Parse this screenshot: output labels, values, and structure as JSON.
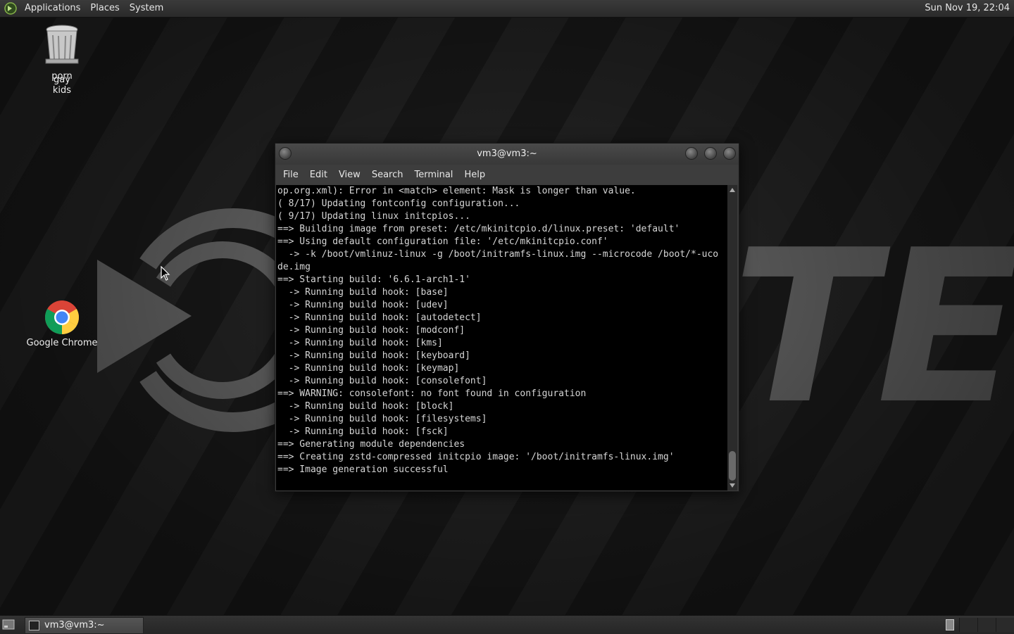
{
  "top_panel": {
    "menus": [
      "Applications",
      "Places",
      "System"
    ],
    "clock": "Sun Nov 19, 22:04"
  },
  "desktop": {
    "trash_label_lines": [
      "porn",
      "gay",
      "kids"
    ],
    "chrome_label": "Google Chrome",
    "wallpaper_text": "TE"
  },
  "terminal": {
    "title": "vm3@vm3:~",
    "menus": [
      "File",
      "Edit",
      "View",
      "Search",
      "Terminal",
      "Help"
    ],
    "lines": [
      "op.org.xml): Error in <match> element: Mask is longer than value.",
      "( 8/17) Updating fontconfig configuration...",
      "( 9/17) Updating linux initcpios...",
      "==> Building image from preset: /etc/mkinitcpio.d/linux.preset: 'default'",
      "==> Using default configuration file: '/etc/mkinitcpio.conf'",
      "  -> -k /boot/vmlinuz-linux -g /boot/initramfs-linux.img --microcode /boot/*-uco",
      "de.img",
      "==> Starting build: '6.6.1-arch1-1'",
      "  -> Running build hook: [base]",
      "  -> Running build hook: [udev]",
      "  -> Running build hook: [autodetect]",
      "  -> Running build hook: [modconf]",
      "  -> Running build hook: [kms]",
      "  -> Running build hook: [keyboard]",
      "  -> Running build hook: [keymap]",
      "  -> Running build hook: [consolefont]",
      "==> WARNING: consolefont: no font found in configuration",
      "  -> Running build hook: [block]",
      "  -> Running build hook: [filesystems]",
      "  -> Running build hook: [fsck]",
      "==> Generating module dependencies",
      "==> Creating zstd-compressed initcpio image: '/boot/initramfs-linux.img'",
      "==> Image generation successful"
    ]
  },
  "taskbar": {
    "task_label": "vm3@vm3:~"
  }
}
